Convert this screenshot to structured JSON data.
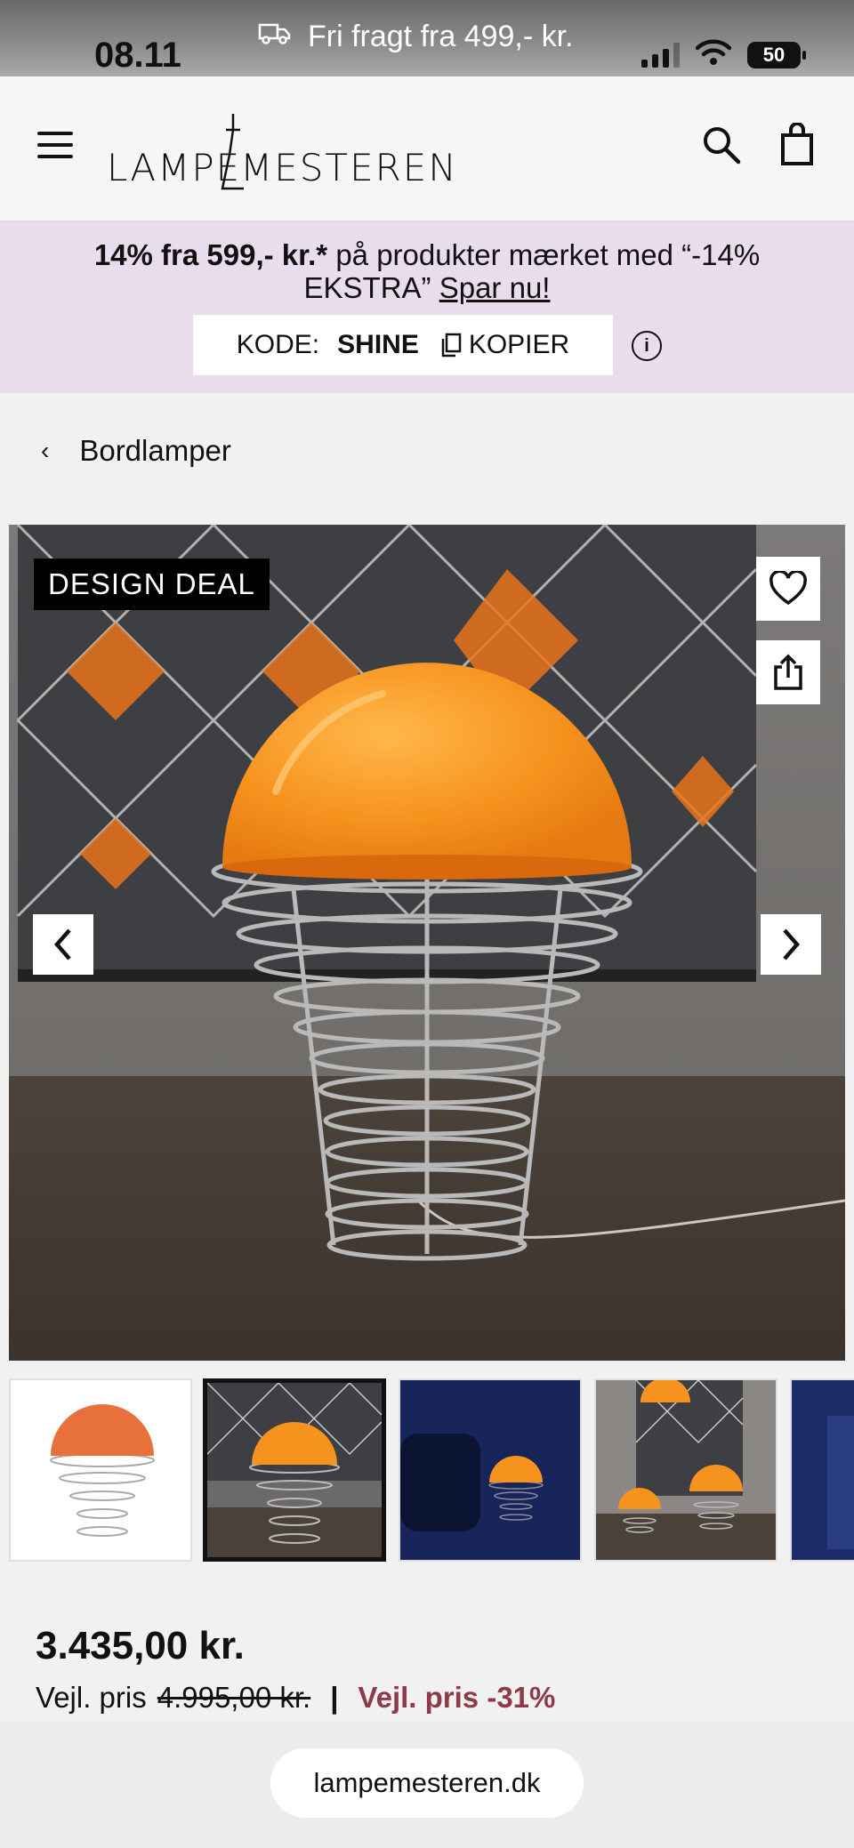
{
  "status_bar": {
    "time": "08.11",
    "shipping": "Fri fragt fra 499,- kr.",
    "battery": "50"
  },
  "header": {
    "logo_left": "LAMPE",
    "logo_right": "MESTEREN"
  },
  "promo": {
    "headline_bold": "14% fra 599,- kr.*",
    "headline_rest": " på produkter mærket med “-14% EKSTRA” ",
    "cta": "Spar nu!",
    "code_label": "KODE:",
    "code": "SHINE",
    "copy_label": "KOPIER"
  },
  "breadcrumb": {
    "label": "Bordlamper"
  },
  "product": {
    "badge": "DESIGN DEAL",
    "price": "3.435,00 kr.",
    "rrp_label": "Vejl. pris",
    "rrp": "4.995,00 kr.",
    "separator": "|",
    "discount": "Vejl. pris -31%"
  },
  "browser": {
    "url": "lampemesteren.dk"
  },
  "colors": {
    "promo_bg": "#e9dcec",
    "discount": "#8e3a48",
    "lamp_orange": "#f6921e"
  }
}
